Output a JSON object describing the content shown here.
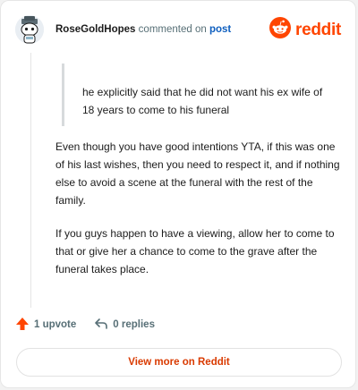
{
  "comment": {
    "username": "RoseGoldHopes",
    "action_text": "commented on",
    "post_link_label": "post",
    "quote": "he explicitly said that he did not want his ex wife of 18 years to come to his funeral",
    "paragraphs": [
      "Even though you have good intentions YTA, if this was one of his last wishes, then you need to respect it, and if nothing else to avoid a scene at the funeral with the rest of the family.",
      "If you guys happen to have a viewing, allow her to come to that or give her a chance to come to the grave after the funeral takes place."
    ]
  },
  "brand": {
    "wordmark": "reddit",
    "color": "#ff4500"
  },
  "actions": {
    "upvote_label": "1 upvote",
    "replies_label": "0 replies"
  },
  "footer": {
    "view_more_label": "View more on Reddit"
  },
  "icons": {
    "avatar": "snoo-avatar-icon",
    "logo": "reddit-logo-icon",
    "upvote": "upvote-arrow-icon",
    "reply": "reply-arrow-icon"
  }
}
